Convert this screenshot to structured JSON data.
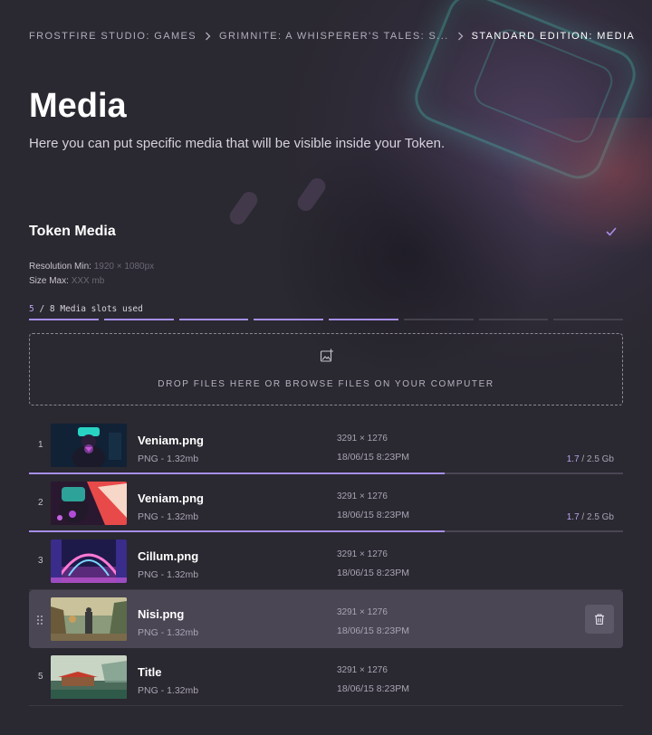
{
  "breadcrumb": {
    "items": [
      "FROSTFIRE STUDIO: GAMES",
      "GRIMNITE: A WHISPERER'S TALES: S...",
      "STANDARD EDITION: MEDIA"
    ]
  },
  "header": {
    "title": "Media",
    "subtitle": "Here you can put specific media that will be visible inside your Token."
  },
  "token_media": {
    "title": "Token Media",
    "resolution_label": "Resolution Min:",
    "resolution_value": "1920 × 1080px",
    "size_label": "Size Max:",
    "size_value": "XXX mb",
    "slots_used": "5",
    "slots_sep": " / ",
    "slots_total": "8",
    "slots_label": " Media slots used",
    "slots_used_count": 5,
    "slots_total_count": 8
  },
  "dropzone": {
    "text": "DROP FILES HERE OR BROWSE FILES ON YOUR COMPUTER"
  },
  "files": [
    {
      "num": "1",
      "name": "Veniam.png",
      "type": "PNG - 1.32mb",
      "dims": "3291 × 1276",
      "date": "18/06/15 8:23PM",
      "uploaded": "1.7",
      "total": " / 2.5 Gb",
      "progress": 0.7
    },
    {
      "num": "2",
      "name": "Veniam.png",
      "type": "PNG - 1.32mb",
      "dims": "3291 × 1276",
      "date": "18/06/15 8:23PM",
      "uploaded": "1.7",
      "total": " / 2.5 Gb",
      "progress": 0.7
    },
    {
      "num": "3",
      "name": "Cillum.png",
      "type": "PNG - 1.32mb",
      "dims": "3291 × 1276",
      "date": "18/06/15 8:23PM"
    },
    {
      "num": "",
      "name": "Nisi.png",
      "type": "PNG - 1.32mb",
      "dims": "3291 × 1276",
      "date": "18/06/15 8:23PM"
    },
    {
      "num": "5",
      "name": "Title",
      "type": "PNG - 1.32mb",
      "dims": "3291 × 1276",
      "date": "18/06/15 8:23PM"
    }
  ],
  "colors": {
    "background": "#2a2830",
    "accent": "#a68ee8",
    "row_hover": "#4a4654"
  }
}
